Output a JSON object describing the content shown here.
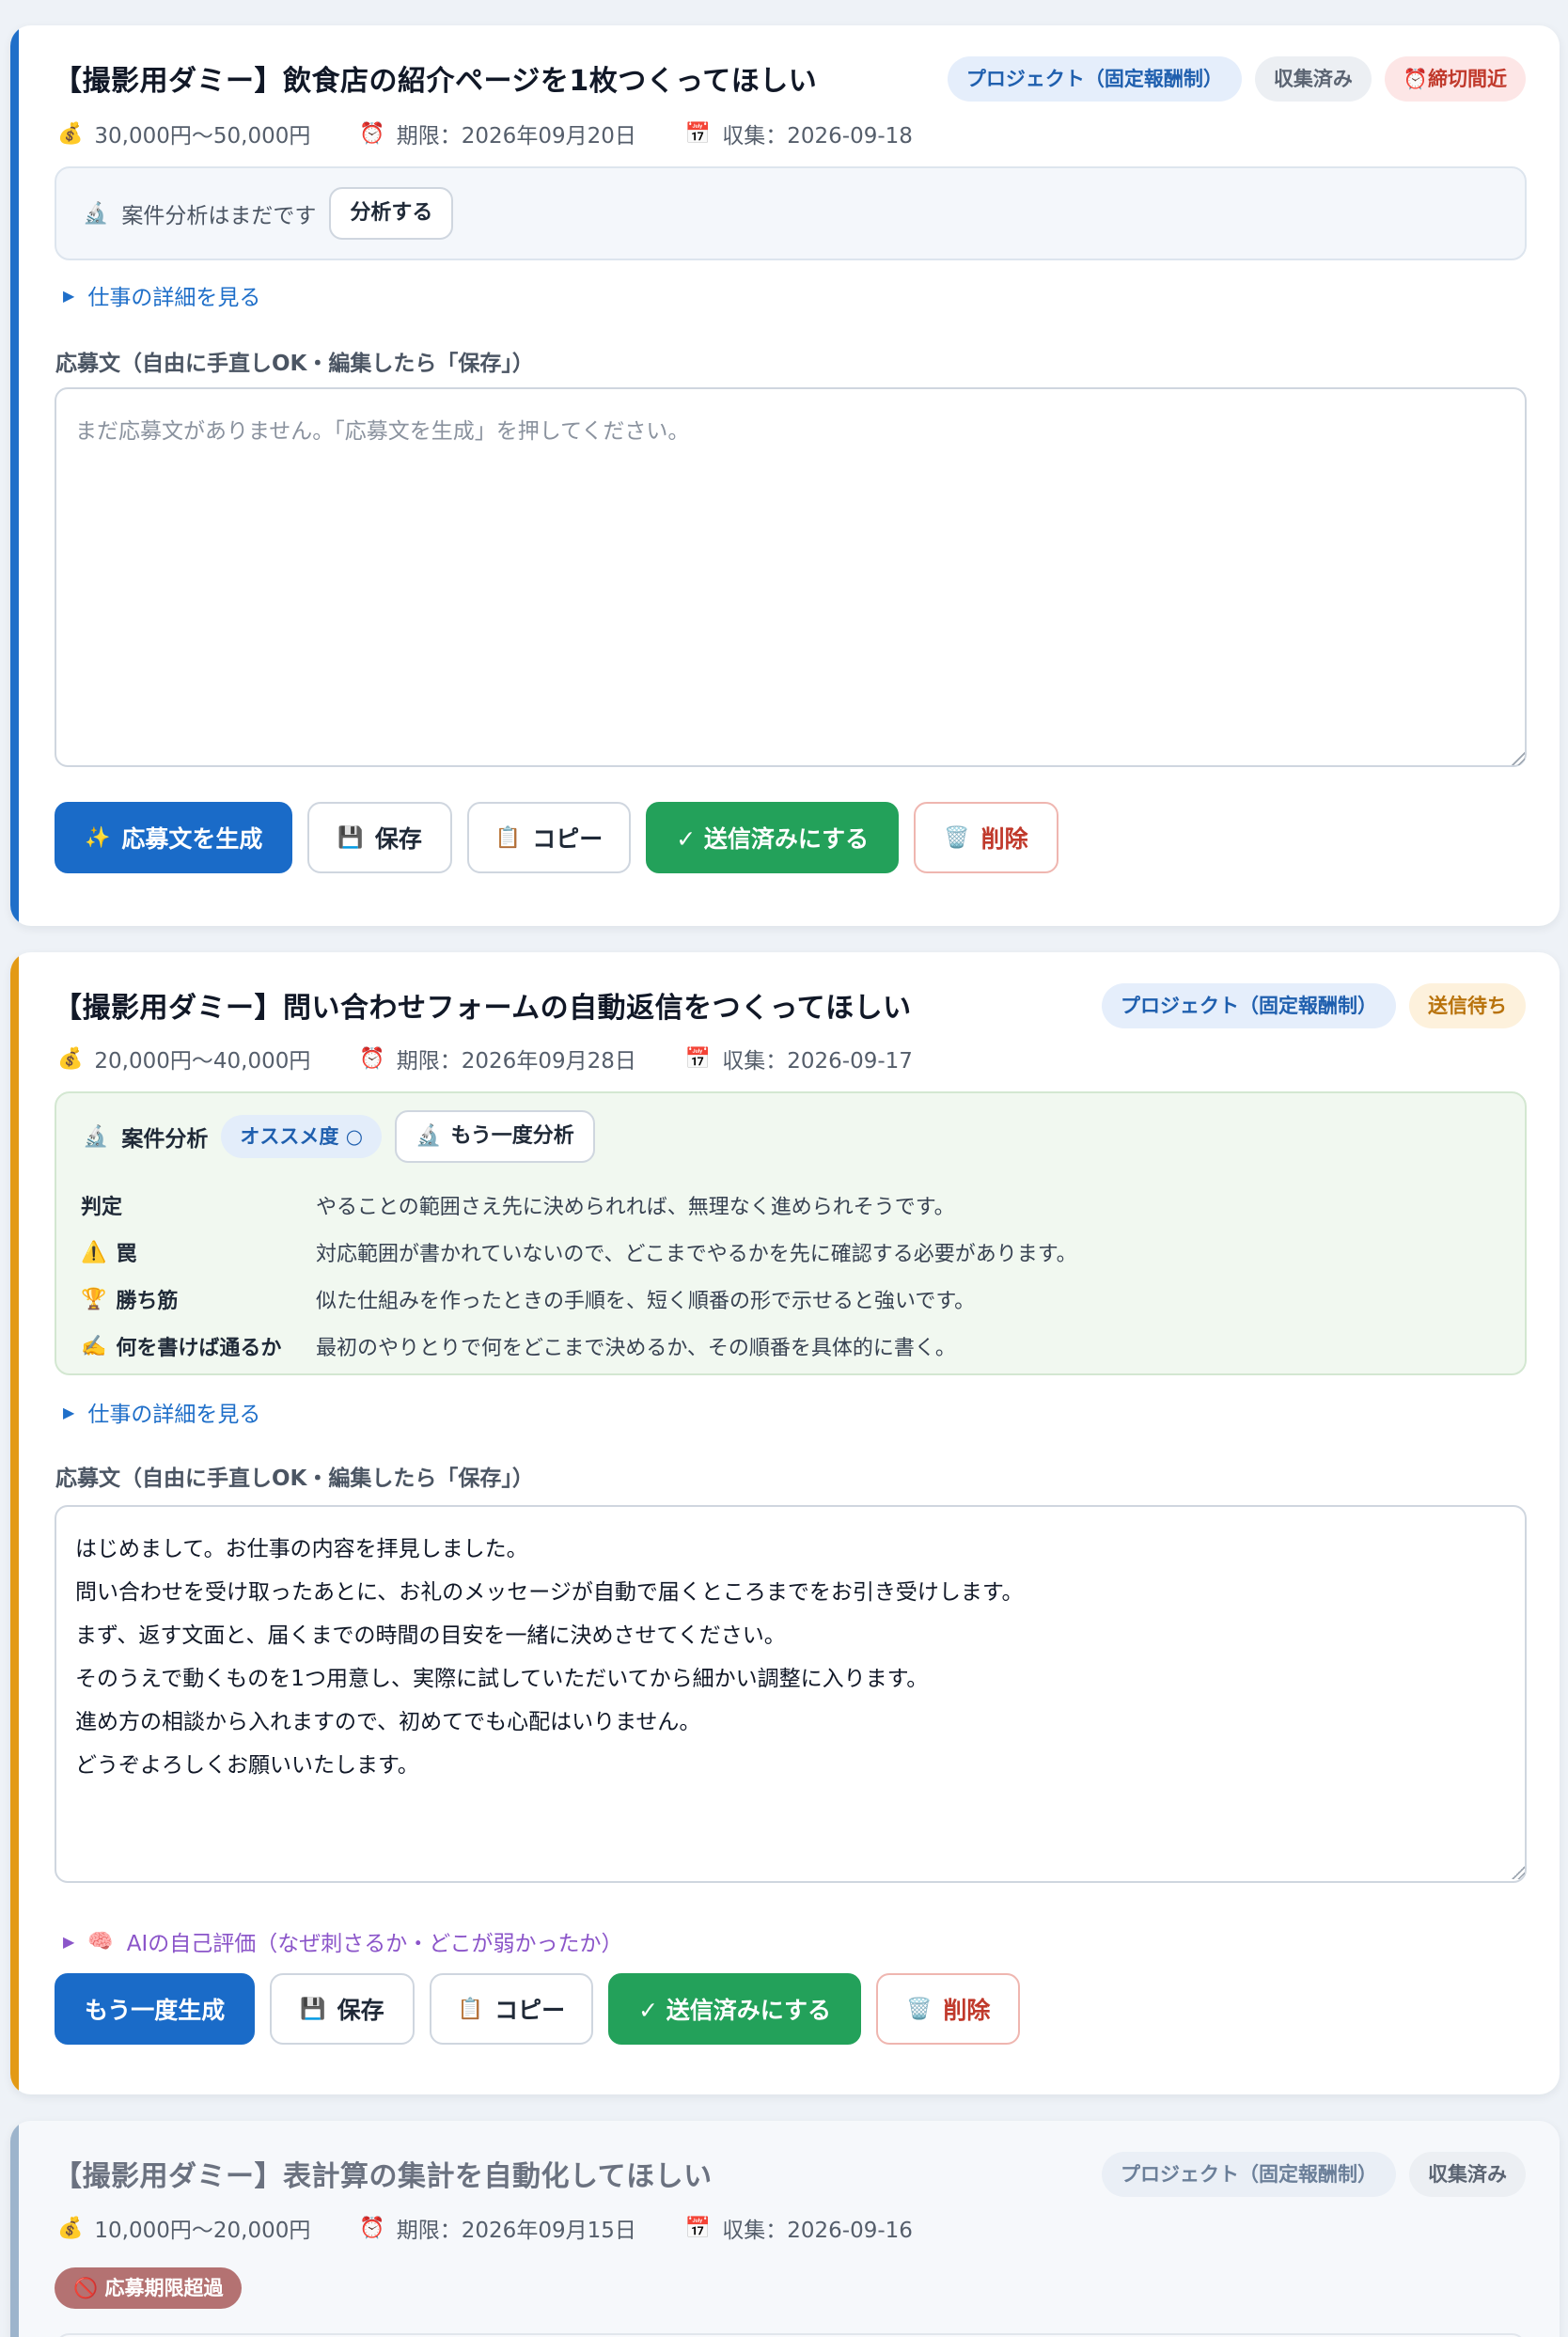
{
  "cards": [
    {
      "title": "【撮影用ダミー】飲食店の紹介ページを1枚つくってほしい",
      "badges": [
        "プロジェクト（固定報酬制）",
        "収集済み",
        "⏰締切間近"
      ],
      "budget": "30,000円〜50,000円",
      "deadline": "期限：2026年09月20日",
      "collected": "収集：2026-09-18",
      "analysis_empty": "案件分析はまだです",
      "analyze_button": "分析する",
      "details_link": "仕事の詳細を見る",
      "proposal_label": "応募文（自由に手直しOK・編集したら「保存」）",
      "proposal_placeholder": "まだ応募文がありません。「応募文を生成」を押してください。",
      "buttons": {
        "generate": "応募文を生成",
        "save": "保存",
        "copy": "コピー",
        "mark_sent": "✓ 送信済みにする",
        "delete": "削除"
      }
    },
    {
      "title": "【撮影用ダミー】問い合わせフォームの自動返信をつくってほしい",
      "badges": [
        "プロジェクト（固定報酬制）",
        "送信待ち"
      ],
      "budget": "20,000円〜40,000円",
      "deadline": "期限：2026年09月28日",
      "collected": "収集：2026-09-17",
      "analysis_title": "案件分析",
      "recommend": "オススメ度 ○",
      "reanalyze_button": "もう一度分析",
      "analysis_rows": [
        {
          "key": "判定",
          "icon": "",
          "value": "やることの範囲さえ先に決められれば、無理なく進められそうです。"
        },
        {
          "key": "罠",
          "icon": "⚠️",
          "value": "対応範囲が書かれていないので、どこまでやるかを先に確認する必要があります。"
        },
        {
          "key": "勝ち筋",
          "icon": "🏆",
          "value": "似た仕組みを作ったときの手順を、短く順番の形で示せると強いです。"
        },
        {
          "key": "何を書けば通るか",
          "icon": "✍️",
          "value": "最初のやりとりで何をどこまで決めるか、その順番を具体的に書く。"
        }
      ],
      "details_link": "仕事の詳細を見る",
      "proposal_label": "応募文（自由に手直しOK・編集したら「保存」）",
      "proposal_text": "はじめまして。お仕事の内容を拝見しました。\n問い合わせを受け取ったあとに、お礼のメッセージが自動で届くところまでをお引き受けします。\nまず、返す文面と、届くまでの時間の目安を一緒に決めさせてください。\nそのうえで動くものを1つ用意し、実際に試していただいてから細かい調整に入ります。\n進め方の相談から入れますので、初めてでも心配はいりません。\nどうぞよろしくお願いいたします。",
      "self_eval_link": "AIの自己評価（なぜ刺さるか・どこが弱かったか）",
      "buttons": {
        "generate": "もう一度生成",
        "save": "保存",
        "copy": "コピー",
        "mark_sent": "✓ 送信済みにする",
        "delete": "削除"
      }
    },
    {
      "title": "【撮影用ダミー】表計算の集計を自動化してほしい",
      "badges": [
        "プロジェクト（固定報酬制）",
        "収集済み"
      ],
      "budget": "10,000円〜20,000円",
      "deadline": "期限：2026年09月15日",
      "collected": "収集：2026-09-16",
      "overdue_badge": "🚫 応募期限超過"
    }
  ],
  "colors": {
    "accent_blue": "#1f6fc9",
    "accent_orange": "#e39a15",
    "accent_grey": "#9db4cc",
    "primary_button": "#1a6bc8",
    "green_button": "#23a15a",
    "danger": "#c0392b"
  },
  "icons": [
    "money-bag-icon",
    "alarm-clock-icon",
    "calendar-icon",
    "microscope-icon",
    "sparkles-icon",
    "floppy-disk-icon",
    "clipboard-icon",
    "trash-icon",
    "brain-icon",
    "warning-icon",
    "trophy-icon",
    "writing-hand-icon",
    "no-entry-icon"
  ]
}
